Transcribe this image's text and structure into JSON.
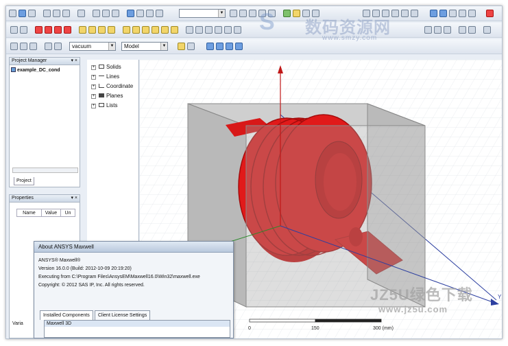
{
  "project_manager": {
    "title": "Project Manager",
    "project_name": "example_DC_cond",
    "tab": "Project"
  },
  "properties": {
    "title": "Properties",
    "columns": [
      "Name",
      "Value",
      "Un"
    ],
    "tab": "Varia"
  },
  "toolbar": {
    "material": "vacuum",
    "mode": "Model"
  },
  "tree": {
    "items": [
      "Solids",
      "Lines",
      "Coordinate",
      "Planes",
      "Lists"
    ]
  },
  "viewport": {
    "scale": {
      "start": "0",
      "mid": "150",
      "end": "300 (mm)"
    },
    "axis_label": "Y"
  },
  "about_dialog": {
    "title": "About ANSYS Maxwell",
    "product": "ANSYS® Maxwell®",
    "version": "Version 16.0.0  (Build: 2012-10-09 20:19:20)",
    "executing": "Executing from C:\\Program Files\\AnsysEM\\Maxwell16.0\\Win32\\maxwell.exe",
    "copyright": "Copyright: © 2012 SAS IP, Inc. All rights reserved.",
    "tabs": [
      "Installed Components",
      "Client License Settings"
    ],
    "list_first": "Maxwell 3D"
  },
  "watermarks": {
    "top_cn": "数码资源网",
    "top_url": "www.smzy.com",
    "bottom_brand": "JZ5U绿色下载",
    "bottom_url": "www.jz5u.com"
  },
  "colors": {
    "coil": "#e11a1a",
    "box": "#a9a9a9",
    "axis_blue": "#2c3fa0",
    "axis_red": "#c01818",
    "axis_green": "#2a8a2a"
  }
}
